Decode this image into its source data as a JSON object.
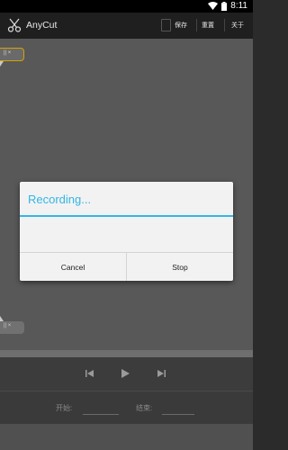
{
  "status_bar": {
    "time": "8:11",
    "icons": [
      "wifi-icon",
      "battery-icon"
    ]
  },
  "app_bar": {
    "title": "AnyCut",
    "logo_icon": "scissors-icon",
    "save_icon": "save-icon",
    "menu": [
      {
        "label": "保存"
      },
      {
        "label": "重置"
      },
      {
        "label": "关于"
      }
    ]
  },
  "editor": {
    "marker_start_label": "|| ×",
    "marker_end_label": "|| ×"
  },
  "transport": {
    "buttons": [
      "skip-previous-icon",
      "play-icon",
      "skip-next-icon"
    ]
  },
  "range": {
    "start_label": "开始:",
    "start_value": "",
    "end_label": "结束:",
    "end_value": ""
  },
  "dialog": {
    "title": "Recording...",
    "cancel_label": "Cancel",
    "stop_label": "Stop"
  },
  "colors": {
    "accent": "#33b5e5",
    "marker_highlight": "#d9a300"
  }
}
